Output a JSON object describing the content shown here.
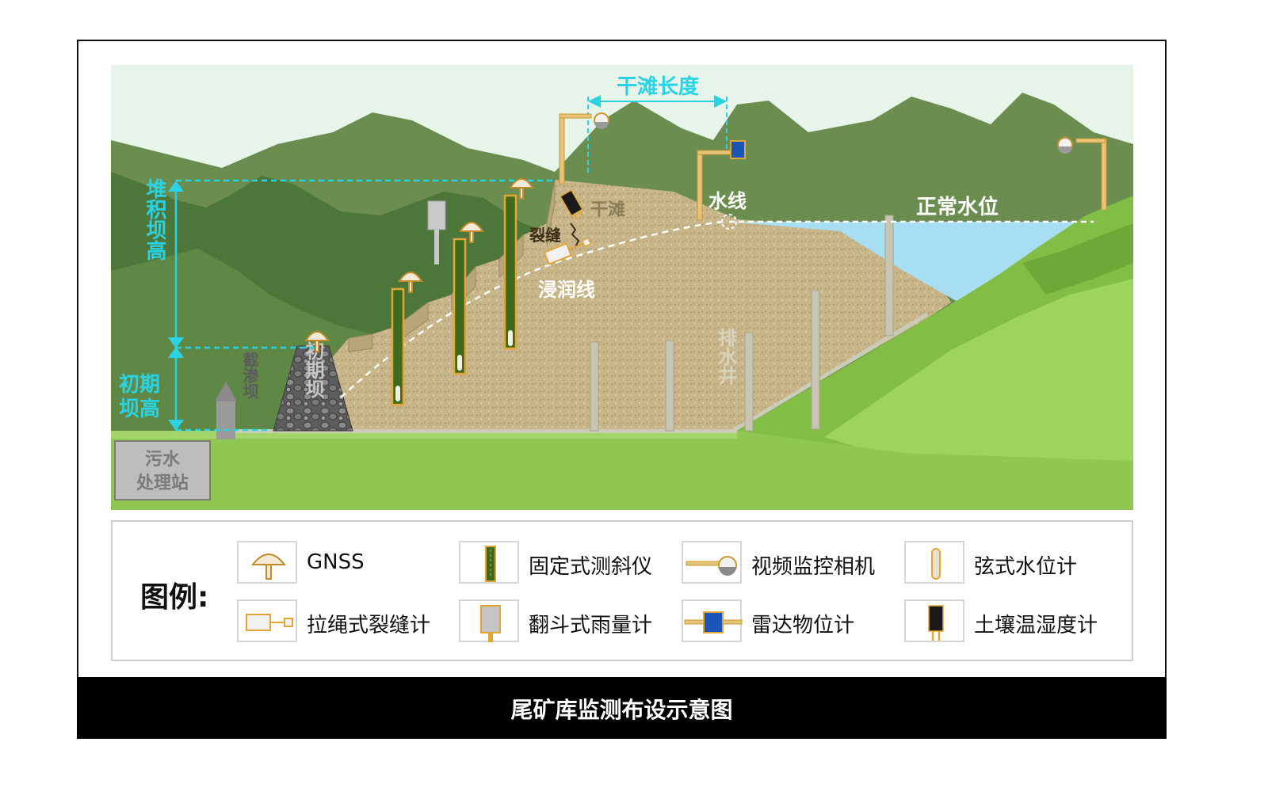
{
  "diagram": {
    "labels": {
      "dry_beach_length": "干滩长度",
      "dry_beach": "干滩",
      "crack": "裂缝",
      "phreatic_line": "浸润线",
      "water_line": "水线",
      "normal_water_level": "正常水位",
      "deposit_dam_height": "堆积坝高",
      "initial_dam_height": "初期坝高",
      "seepage_dam": "截渗坝",
      "initial_dam": "初期坝",
      "drainage_well": "排水井",
      "sewage_plant": "污水处理站"
    }
  },
  "legend": {
    "title": "图例:",
    "items": [
      {
        "label": "GNSS",
        "icon": "gnss-icon"
      },
      {
        "label": "固定式测斜仪",
        "icon": "inclinometer-icon"
      },
      {
        "label": "视频监控相机",
        "icon": "camera-icon"
      },
      {
        "label": "弦式水位计",
        "icon": "water-level-meter-icon"
      },
      {
        "label": "拉绳式裂缝计",
        "icon": "crack-meter-icon"
      },
      {
        "label": "翻斗式雨量计",
        "icon": "rain-gauge-icon"
      },
      {
        "label": "雷达物位计",
        "icon": "radar-level-icon"
      },
      {
        "label": "土壤温湿度计",
        "icon": "soil-sensor-icon"
      }
    ]
  },
  "caption": "尾矿库监测布设示意图",
  "colors": {
    "accent_cyan": "#2ad3e4",
    "sky": "#e9f6ee",
    "far_mountain": "#6a8f52",
    "near_mountain": "#4f7a3c",
    "grass": "#8ec74e",
    "tailings": "#c6b58a",
    "water": "#a9dff2",
    "sensor_gold": "#e3a534",
    "inclinometer_green": "#3f6a1d",
    "radar_blue": "#1b55b8"
  }
}
